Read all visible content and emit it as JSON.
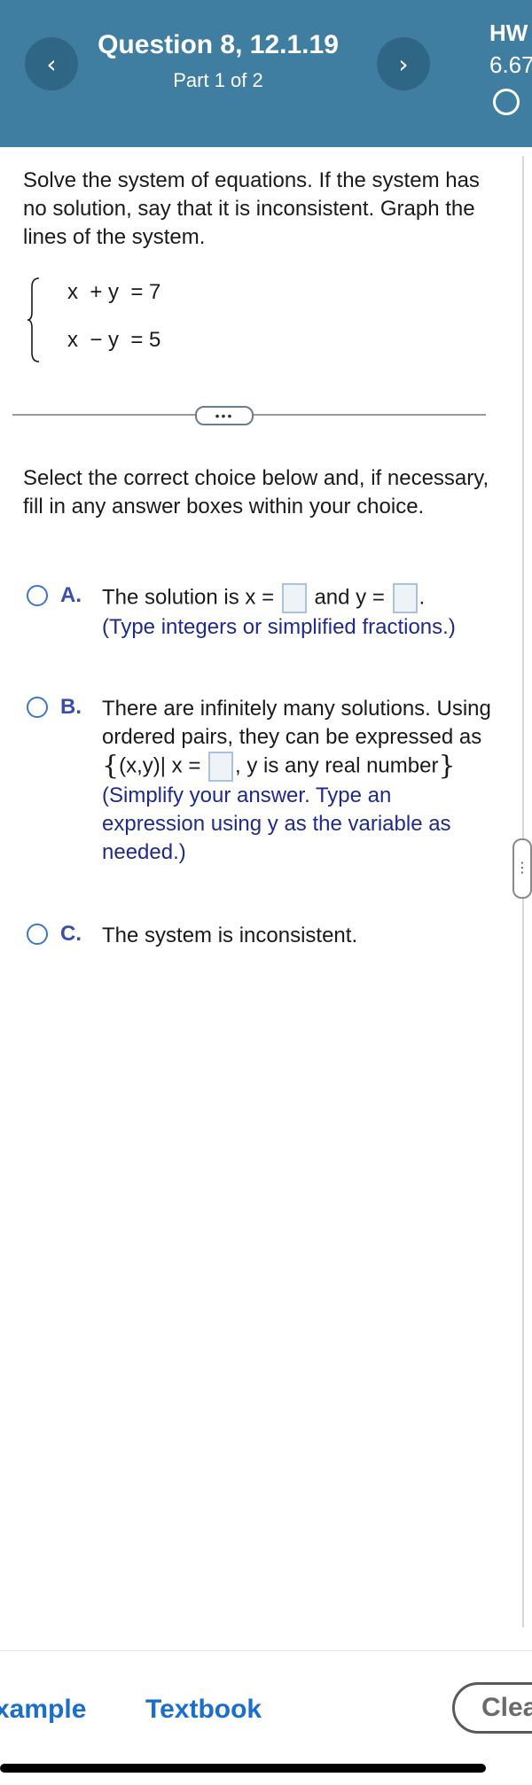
{
  "header": {
    "title": "Question 8, 12.1.19",
    "part": "Part 1 of 2",
    "hw_label": "HW",
    "hw_score": "6.67",
    "prev_icon": "chevron-left-icon",
    "next_icon": "chevron-right-icon",
    "prev_glyph": "‹",
    "next_glyph": "›"
  },
  "question": {
    "instructions": "Solve the system of equations. If the system has no solution, say that it is inconsistent. Graph the lines of the system.",
    "equations": [
      "x  + y  = 7",
      "x  − y  = 5"
    ],
    "select_text": "Select the correct choice below and, if necessary, fill in any answer boxes within your choice."
  },
  "choices": {
    "a": {
      "letter": "A.",
      "text_pre": "The solution is x =",
      "text_mid": "and y =",
      "text_post": ".",
      "hint": "(Type integers or simplified fractions.)"
    },
    "b": {
      "letter": "B.",
      "text": "There are infinitely many solutions. Using ordered pairs, they can be expressed as",
      "set_open": "{",
      "set_pre": "(x,y)| x =",
      "set_post": ", y is any real number",
      "set_close": "}",
      "hint": "(Simplify your answer. Type an expression using y as the variable as needed.)"
    },
    "c": {
      "letter": "C.",
      "text": "The system is inconsistent."
    }
  },
  "bottom": {
    "example_label": "xample",
    "textbook_label": "Textbook",
    "clear_label": "Clea"
  },
  "colors": {
    "header_bg": "#3f7ea1",
    "link_blue": "#1b6fc9",
    "choice_letter": "#3a4fa8",
    "hint_text": "#1f2a8a"
  }
}
